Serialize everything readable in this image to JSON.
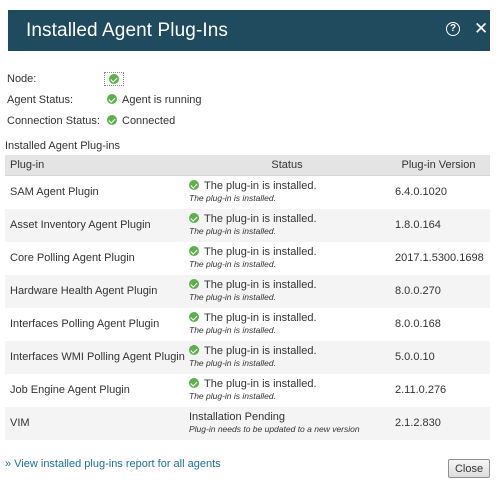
{
  "dialog": {
    "title": "Installed Agent Plug-Ins",
    "help_icon": "?",
    "close_icon": "✕"
  },
  "info": {
    "node_label": "Node:",
    "agent_status_label": "Agent Status:",
    "agent_status_value": "Agent is running",
    "connection_status_label": "Connection Status:",
    "connection_status_value": "Connected"
  },
  "plugins": {
    "section_label": "Installed Agent Plug-ins",
    "columns": {
      "name": "Plug-in",
      "status": "Status",
      "version": "Plug-in Version"
    },
    "rows": [
      {
        "name": "SAM Agent Plugin",
        "status": "The plug-in is installed.",
        "status_detail": "The plug-in is installed.",
        "status_icon": "check-icon",
        "version": "6.4.0.1020"
      },
      {
        "name": "Asset Inventory Agent Plugin",
        "status": "The plug-in is installed.",
        "status_detail": "The plug-in is installed.",
        "status_icon": "check-icon",
        "version": "1.8.0.164"
      },
      {
        "name": "Core Polling Agent Plugin",
        "status": "The plug-in is installed.",
        "status_detail": "The plug-in is installed.",
        "status_icon": "check-icon",
        "version": "2017.1.5300.1698"
      },
      {
        "name": "Hardware Health Agent Plugin",
        "status": "The plug-in is installed.",
        "status_detail": "The plug-in is installed.",
        "status_icon": "check-icon",
        "version": "8.0.0.270"
      },
      {
        "name": "Interfaces Polling Agent Plugin",
        "status": "The plug-in is installed.",
        "status_detail": "The plug-in is installed.",
        "status_icon": "check-icon",
        "version": "8.0.0.168"
      },
      {
        "name": "Interfaces WMI Polling Agent Plugin",
        "status": "The plug-in is installed.",
        "status_detail": "The plug-in is installed.",
        "status_icon": "check-icon",
        "version": "5.0.0.10"
      },
      {
        "name": "Job Engine Agent Plugin",
        "status": "The plug-in is installed.",
        "status_detail": "The plug-in is installed.",
        "status_icon": "check-icon",
        "version": "2.11.0.276"
      },
      {
        "name": "VIM",
        "status": "Installation Pending",
        "status_detail": "Plug-in needs to be updated to a new version",
        "status_icon": "",
        "version": "2.1.2.830"
      }
    ]
  },
  "footer": {
    "report_link": "» View installed plug-ins report for all agents",
    "close_button": "Close"
  },
  "colors": {
    "titlebar": "#204a5e",
    "success": "#5cb14a",
    "link": "#1e6ea0"
  }
}
